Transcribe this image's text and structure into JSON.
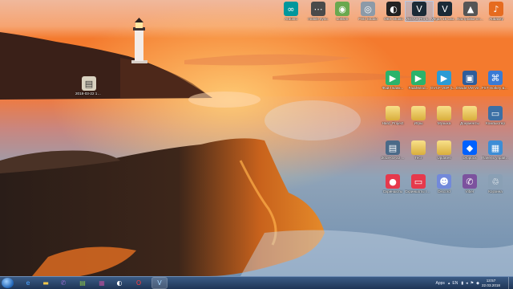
{
  "desktop": {
    "top_row": [
      {
        "name": "arduino-icon",
        "label": "Arduino",
        "glyph": "∞",
        "color": "#00979c"
      },
      {
        "name": "share-icon",
        "label": "mobile sync.",
        "glyph": "⋯",
        "color": "#4a4a4a"
      },
      {
        "name": "globe-icon",
        "label": "Loksim",
        "glyph": "◉",
        "color": "#6aa84f"
      },
      {
        "name": "disk-icon",
        "label": "FSD Studio",
        "glyph": "◎",
        "color": "#8c9aa8"
      },
      {
        "name": "obs-icon",
        "label": "OBS Studio",
        "glyph": "◐",
        "color": "#222"
      },
      {
        "name": "vegas-icon",
        "label": "VEGAS Pro 16.0",
        "glyph": "V",
        "color": "#1b2a36",
        "selected": true
      },
      {
        "name": "vegas-icon",
        "label": "Vegas 15 Laure...",
        "glyph": "V",
        "color": "#1b2a36"
      },
      {
        "name": "photo-icon",
        "label": "Настройки спеченного",
        "glyph": "▲",
        "color": "#555"
      },
      {
        "name": "audacity-icon",
        "label": "Audacity",
        "glyph": "♪",
        "color": "#e66b1f"
      }
    ],
    "left_file": {
      "label": "2018-03-22 13.20.31.wav",
      "glyph": "▤"
    },
    "grid": [
      {
        "name": "wav-icon",
        "label": "Файл Банк...",
        "glyph": "▶",
        "color": "#2bb36b",
        "row": 0,
        "col": 0
      },
      {
        "name": "wav-icon",
        "label": "FaddWind...",
        "glyph": "▶",
        "color": "#2bb36b",
        "row": 0,
        "col": 1
      },
      {
        "name": "mp3-icon",
        "label": "GVCF VDP (Lutoch_v) ...",
        "glyph": "▶",
        "color": "#2b9bd4",
        "row": 0,
        "col": 2
      },
      {
        "name": "virtualbox-icon",
        "label": "Oracle VM VirtualBox",
        "glyph": "▣",
        "color": "#2e5d9a",
        "row": 0,
        "col": 3
      },
      {
        "name": "config-icon",
        "label": "FST Hotkey & Keyboard ...",
        "glyph": "⌘",
        "color": "#3a7bd5",
        "row": 0,
        "col": 4
      },
      {
        "name": "folder-icon",
        "label": "Hard_Project",
        "glyph": "",
        "color": "",
        "row": 1,
        "col": 0
      },
      {
        "name": "folder-icon",
        "label": "Игры",
        "glyph": "",
        "color": "",
        "row": 1,
        "col": 1
      },
      {
        "name": "folder-icon",
        "label": "Музыка",
        "glyph": "",
        "color": "",
        "row": 1,
        "col": 2
      },
      {
        "name": "folder-icon",
        "label": "Документы",
        "glyph": "",
        "color": "",
        "row": 1,
        "col": 3
      },
      {
        "name": "computer-icon",
        "label": "Компьютер",
        "glyph": "▭",
        "color": "#3b6fa5",
        "row": 1,
        "col": 4
      },
      {
        "name": "image-icon",
        "label": "2018-03-22 ...",
        "glyph": "▤",
        "color": "#4b6a88",
        "row": 2,
        "col": 0
      },
      {
        "name": "folder-icon",
        "label": "Тест",
        "glyph": "",
        "color": "",
        "row": 2,
        "col": 1
      },
      {
        "name": "folder-icon",
        "label": "Updates",
        "glyph": "",
        "color": "",
        "row": 2,
        "col": 2
      },
      {
        "name": "dropbox-icon",
        "label": "Dropbox",
        "glyph": "◆",
        "color": "#0061fe",
        "row": 2,
        "col": 3
      },
      {
        "name": "control-panel-icon",
        "label": "Панель управления",
        "glyph": "▦",
        "color": "#3d8dd6",
        "row": 2,
        "col": 4
      },
      {
        "name": "screenshot-icon",
        "label": "Скриншоты",
        "glyph": "●",
        "color": "#e6394c",
        "row": 3,
        "col": 0
      },
      {
        "name": "screen-icon",
        "label": "Скриншоты IdeaR",
        "glyph": "▭",
        "color": "#e6394c",
        "row": 3,
        "col": 1
      },
      {
        "name": "discord-icon",
        "label": "Discord",
        "glyph": "☻",
        "color": "#7289da",
        "row": 3,
        "col": 2
      },
      {
        "name": "viber-icon",
        "label": "Viber",
        "glyph": "✆",
        "color": "#7c529e",
        "row": 3,
        "col": 3
      },
      {
        "name": "recycle-bin-icon",
        "label": "Корзина",
        "glyph": "♲",
        "color": "#8aa0b5",
        "row": 3,
        "col": 4
      }
    ]
  },
  "taskbar": {
    "buttons": [
      {
        "name": "ie-icon",
        "glyph": "e",
        "color": "#4aa3ff"
      },
      {
        "name": "explorer-icon",
        "glyph": "▬",
        "color": "#f1c84b"
      },
      {
        "name": "viber-icon",
        "glyph": "✆",
        "color": "#9a6cd1"
      },
      {
        "name": "notepad-icon",
        "glyph": "▤",
        "color": "#8bc34a"
      },
      {
        "name": "archive-icon",
        "glyph": "▦",
        "color": "#b04f9a"
      },
      {
        "name": "obs-icon",
        "glyph": "◐",
        "color": "#ffffff"
      },
      {
        "name": "opera-icon",
        "glyph": "O",
        "color": "#ff3b3b"
      },
      {
        "name": "vegas-icon",
        "glyph": "V",
        "color": "#a8d8ff",
        "active": true
      }
    ],
    "tray": {
      "apps_label": "Apps",
      "lang": "EN",
      "time": "13:57",
      "date": "22.03.2018"
    }
  }
}
